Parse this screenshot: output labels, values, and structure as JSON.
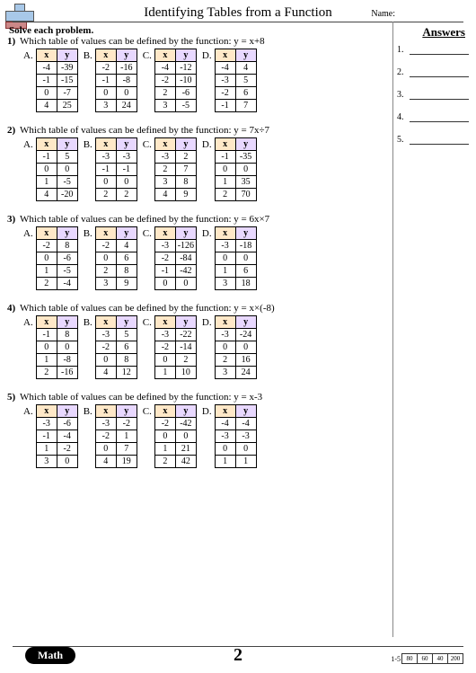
{
  "title": "Identifying Tables from a Function",
  "name_label": "Name:",
  "instructions": "Solve each problem.",
  "answers_heading": "Answers",
  "page_number": "2",
  "footer_label": "Math",
  "score": {
    "label": "1-5",
    "boxes": [
      "80",
      "60",
      "40",
      "200"
    ]
  },
  "answer_lines": [
    "1.",
    "2.",
    "3.",
    "4.",
    "5."
  ],
  "col_x": "x",
  "col_y": "y",
  "option_labels": [
    "A.",
    "B.",
    "C.",
    "D."
  ],
  "problems": [
    {
      "n": "1)",
      "text": "Which table of values can be defined by the function: y = x+8",
      "tables": [
        [
          [
            "-4",
            "-39"
          ],
          [
            "-1",
            "-15"
          ],
          [
            "0",
            "-7"
          ],
          [
            "4",
            "25"
          ]
        ],
        [
          [
            "-2",
            "-16"
          ],
          [
            "-1",
            "-8"
          ],
          [
            "0",
            "0"
          ],
          [
            "3",
            "24"
          ]
        ],
        [
          [
            "-4",
            "-12"
          ],
          [
            "-2",
            "-10"
          ],
          [
            "2",
            "-6"
          ],
          [
            "3",
            "-5"
          ]
        ],
        [
          [
            "-4",
            "4"
          ],
          [
            "-3",
            "5"
          ],
          [
            "-2",
            "6"
          ],
          [
            "-1",
            "7"
          ]
        ]
      ]
    },
    {
      "n": "2)",
      "text": "Which table of values can be defined by the function: y = 7x÷7",
      "tables": [
        [
          [
            "-1",
            "5"
          ],
          [
            "0",
            "0"
          ],
          [
            "1",
            "-5"
          ],
          [
            "4",
            "-20"
          ]
        ],
        [
          [
            "-3",
            "-3"
          ],
          [
            "-1",
            "-1"
          ],
          [
            "0",
            "0"
          ],
          [
            "2",
            "2"
          ]
        ],
        [
          [
            "-3",
            "2"
          ],
          [
            "2",
            "7"
          ],
          [
            "3",
            "8"
          ],
          [
            "4",
            "9"
          ]
        ],
        [
          [
            "-1",
            "-35"
          ],
          [
            "0",
            "0"
          ],
          [
            "1",
            "35"
          ],
          [
            "2",
            "70"
          ]
        ]
      ]
    },
    {
      "n": "3)",
      "text": "Which table of values can be defined by the function: y = 6x×7",
      "tables": [
        [
          [
            "-2",
            "8"
          ],
          [
            "0",
            "-6"
          ],
          [
            "1",
            "-5"
          ],
          [
            "2",
            "-4"
          ]
        ],
        [
          [
            "-2",
            "4"
          ],
          [
            "0",
            "6"
          ],
          [
            "2",
            "8"
          ],
          [
            "3",
            "9"
          ]
        ],
        [
          [
            "-3",
            "-126"
          ],
          [
            "-2",
            "-84"
          ],
          [
            "-1",
            "-42"
          ],
          [
            "0",
            "0"
          ]
        ],
        [
          [
            "-3",
            "-18"
          ],
          [
            "0",
            "0"
          ],
          [
            "1",
            "6"
          ],
          [
            "3",
            "18"
          ]
        ]
      ]
    },
    {
      "n": "4)",
      "text": "Which table of values can be defined by the function: y = x×(-8)",
      "tables": [
        [
          [
            "-1",
            "8"
          ],
          [
            "0",
            "0"
          ],
          [
            "1",
            "-8"
          ],
          [
            "2",
            "-16"
          ]
        ],
        [
          [
            "-3",
            "5"
          ],
          [
            "-2",
            "6"
          ],
          [
            "0",
            "8"
          ],
          [
            "4",
            "12"
          ]
        ],
        [
          [
            "-3",
            "-22"
          ],
          [
            "-2",
            "-14"
          ],
          [
            "0",
            "2"
          ],
          [
            "1",
            "10"
          ]
        ],
        [
          [
            "-3",
            "-24"
          ],
          [
            "0",
            "0"
          ],
          [
            "2",
            "16"
          ],
          [
            "3",
            "24"
          ]
        ]
      ]
    },
    {
      "n": "5)",
      "text": "Which table of values can be defined by the function: y = x-3",
      "tables": [
        [
          [
            "-3",
            "-6"
          ],
          [
            "-1",
            "-4"
          ],
          [
            "1",
            "-2"
          ],
          [
            "3",
            "0"
          ]
        ],
        [
          [
            "-3",
            "-2"
          ],
          [
            "-2",
            "1"
          ],
          [
            "0",
            "7"
          ],
          [
            "4",
            "19"
          ]
        ],
        [
          [
            "-2",
            "-42"
          ],
          [
            "0",
            "0"
          ],
          [
            "1",
            "21"
          ],
          [
            "2",
            "42"
          ]
        ],
        [
          [
            "-4",
            "-4"
          ],
          [
            "-3",
            "-3"
          ],
          [
            "0",
            "0"
          ],
          [
            "1",
            "1"
          ]
        ]
      ]
    }
  ]
}
